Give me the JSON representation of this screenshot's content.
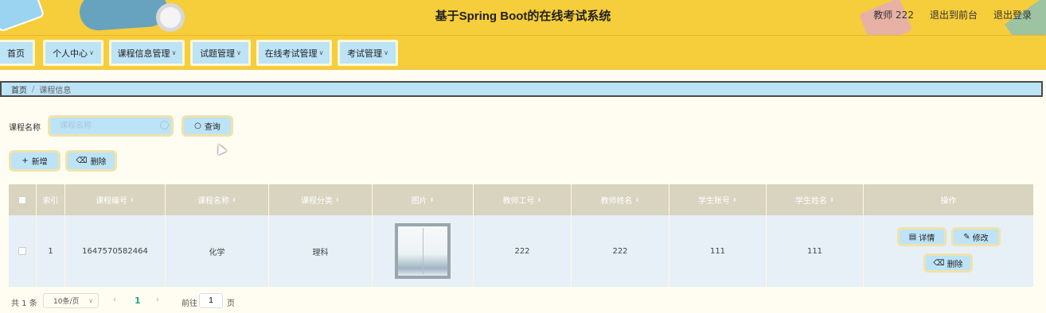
{
  "header": {
    "title": "基于Spring Boot的在线考试系统",
    "user": "教师 222",
    "exit_front": "退出到前台",
    "logout": "退出登录"
  },
  "nav": {
    "items": [
      {
        "label": "首页",
        "dropdown": false
      },
      {
        "label": "个人中心",
        "dropdown": true
      },
      {
        "label": "课程信息管理",
        "dropdown": true
      },
      {
        "label": "试题管理",
        "dropdown": true
      },
      {
        "label": "在线考试管理",
        "dropdown": true
      },
      {
        "label": "考试管理",
        "dropdown": true
      }
    ]
  },
  "breadcrumb": {
    "home": "首页",
    "separator": "/",
    "current": "课程信息"
  },
  "search": {
    "label": "课程名称",
    "placeholder": "课程名称",
    "query_button": "查询"
  },
  "actions": {
    "add": "新增",
    "delete": "删除"
  },
  "table": {
    "headers": [
      "索引",
      "课程编号",
      "课程名称",
      "课程分类",
      "图片",
      "教师工号",
      "教师姓名",
      "学生账号",
      "学生姓名",
      "操作"
    ],
    "rows": [
      {
        "index": "1",
        "course_no": "1647570582464",
        "course_name": "化学",
        "category": "理科",
        "teacher_no": "222",
        "teacher_name": "222",
        "student_account": "111",
        "student_name": "111",
        "ops": {
          "detail": "详情",
          "edit": "修改",
          "delete": "删除"
        }
      }
    ]
  },
  "pagination": {
    "total": "共 1 条",
    "page_size": "10条/页",
    "current_page": "1",
    "goto_label": "前往",
    "goto_value": "1",
    "page_suffix": "页"
  },
  "colors": {
    "header_bg": "#f6cd3a",
    "button_bg": "#bde3f6",
    "table_header_bg": "#d9d4bf",
    "row_bg": "#e6f0f6",
    "active_page": "#2a9d8f"
  },
  "icons": {
    "query": "search-icon",
    "add": "plus-icon",
    "delete": "trash-icon",
    "detail": "document-icon",
    "edit": "pencil-icon"
  }
}
